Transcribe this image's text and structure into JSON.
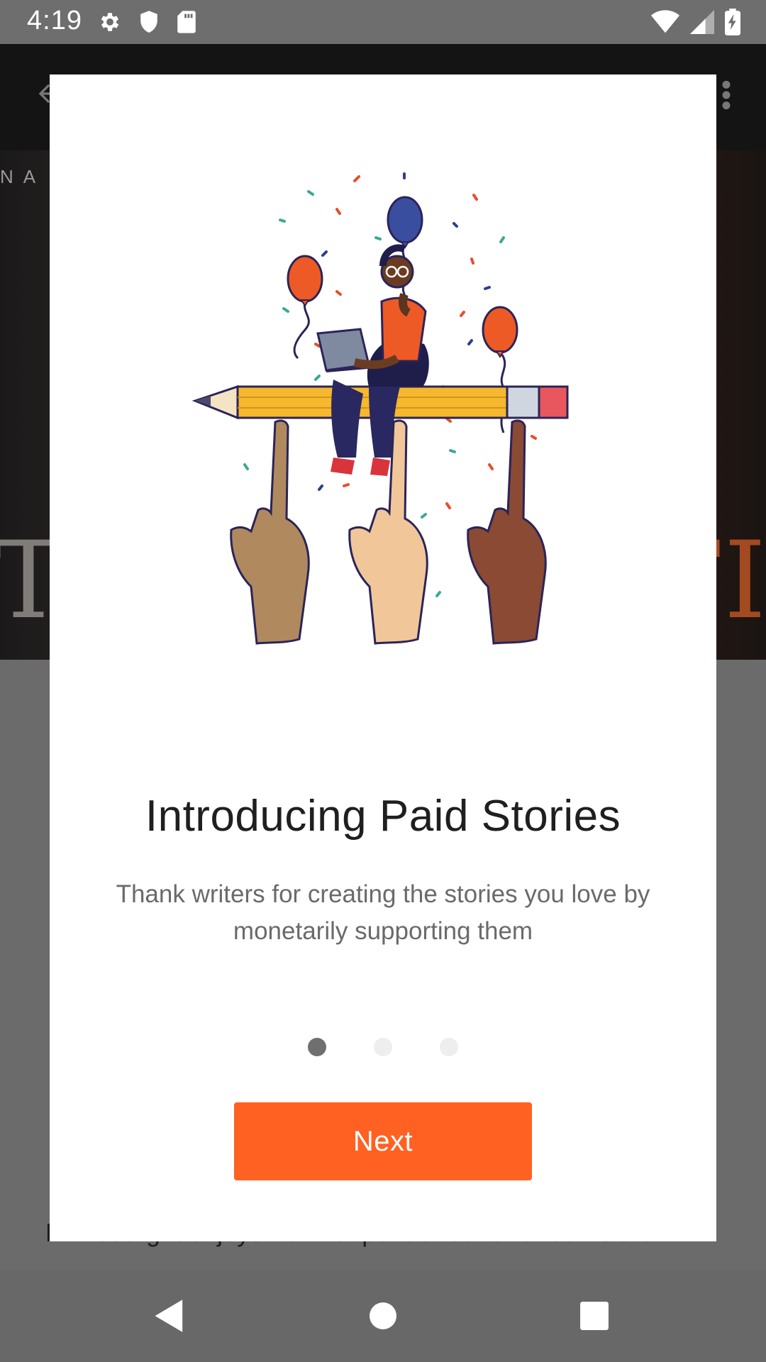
{
  "status_bar": {
    "time": "4:19",
    "left_icons": [
      "gear-icon",
      "shield-icon",
      "sd-card-icon"
    ],
    "right_icons": [
      "wifi-icon",
      "signal-icon",
      "battery-charging-icon"
    ]
  },
  "background": {
    "cover_left_text": "NA",
    "cover_big_left": "T",
    "cover_big_right": "FI",
    "description": "L… Cutright enjoys her independence. She roams the woods"
  },
  "modal": {
    "title": "Introducing Paid Stories",
    "subtitle": "Thank writers for creating the stories you love by monetarily supporting them",
    "pager": {
      "count": 3,
      "active_index": 0
    },
    "next_label": "Next"
  },
  "colors": {
    "accent": "#ff6122",
    "dot_active": "#6f6f6f",
    "dot_inactive": "#eeeeee"
  },
  "nav_bar": {
    "buttons": [
      "back-icon",
      "home-icon",
      "recents-icon"
    ]
  }
}
